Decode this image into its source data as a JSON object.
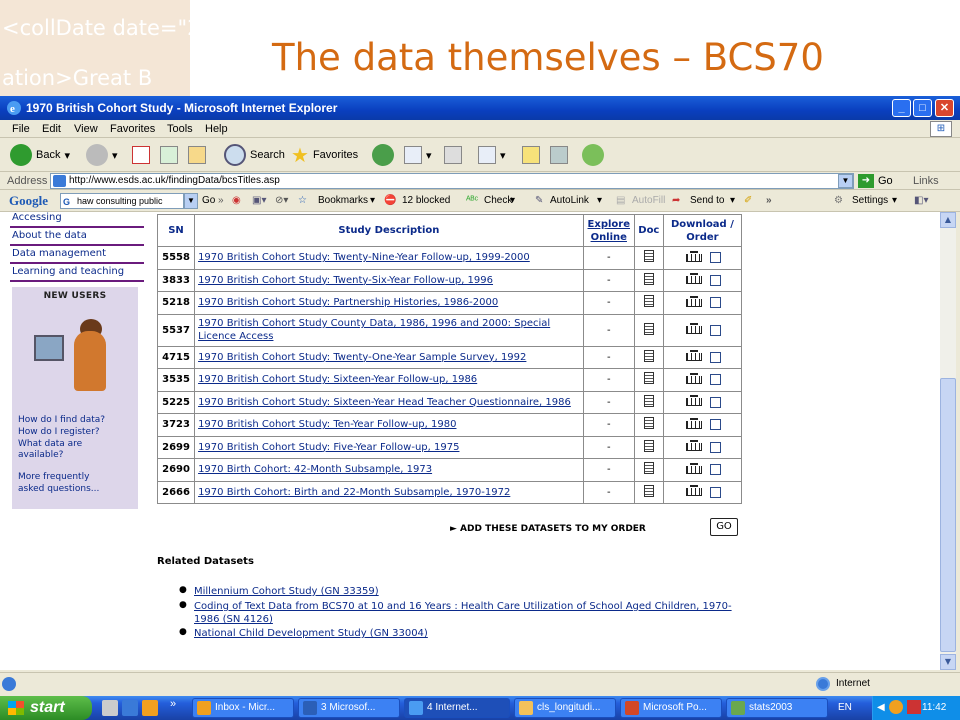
{
  "slide": {
    "title": "The data themselves – BCS70",
    "decor_line1": "<collDate date=\"2",
    "decor_line2": "ation>Great B"
  },
  "window": {
    "title": "1970 British Cohort Study - Microsoft Internet Explorer",
    "menu": [
      "File",
      "Edit",
      "View",
      "Favorites",
      "Tools",
      "Help"
    ],
    "toolbar": {
      "back": "Back",
      "search": "Search",
      "favorites": "Favorites"
    },
    "address_label": "Address",
    "url": "http://www.esds.ac.uk/findingData/bcsTitles.asp",
    "go": "Go",
    "links": "Links"
  },
  "google_bar": {
    "logo": "Google",
    "search_text": "haw consulting public",
    "go": "Go",
    "bookmarks": "Bookmarks",
    "blocked": "12 blocked",
    "check": "Check",
    "autolink": "AutoLink",
    "autofill": "AutoFill",
    "sendto": "Send to",
    "settings": "Settings"
  },
  "sidebar": {
    "links": [
      "Accessing",
      "About the data",
      "Data management",
      "Learning and teaching"
    ],
    "new_users": "NEW USERS",
    "help": [
      "How do I find data?",
      "How do I register?",
      "What data are",
      "available?",
      "More frequently",
      "asked questions..."
    ]
  },
  "table": {
    "headers": {
      "sn": "SN",
      "desc": "Study Description",
      "explore": "Explore Online",
      "doc": "Doc",
      "download": "Download / Order"
    },
    "rows": [
      {
        "sn": "5558",
        "desc": "1970 British Cohort Study: Twenty-Nine-Year Follow-up, 1999-2000",
        "explore": "-"
      },
      {
        "sn": "3833",
        "desc": "1970 British Cohort Study: Twenty-Six-Year Follow-up, 1996",
        "explore": "-"
      },
      {
        "sn": "5218",
        "desc": "1970 British Cohort Study: Partnership Histories, 1986-2000",
        "explore": "-"
      },
      {
        "sn": "5537",
        "desc": "1970 British Cohort Study County Data, 1986, 1996 and 2000: Special Licence Access",
        "explore": "-"
      },
      {
        "sn": "4715",
        "desc": "1970 British Cohort Study: Twenty-One-Year Sample Survey, 1992",
        "explore": "-"
      },
      {
        "sn": "3535",
        "desc": "1970 British Cohort Study: Sixteen-Year Follow-up, 1986",
        "explore": "-"
      },
      {
        "sn": "5225",
        "desc": "1970 British Cohort Study: Sixteen-Year Head Teacher Questionnaire, 1986",
        "explore": "-"
      },
      {
        "sn": "3723",
        "desc": "1970 British Cohort Study: Ten-Year Follow-up, 1980",
        "explore": "-"
      },
      {
        "sn": "2699",
        "desc": "1970 British Cohort Study: Five-Year Follow-up, 1975",
        "explore": "-"
      },
      {
        "sn": "2690",
        "desc": "1970 Birth Cohort: 42-Month Subsample, 1973",
        "explore": "-"
      },
      {
        "sn": "2666",
        "desc": "1970 Birth Cohort: Birth and 22-Month Subsample, 1970-1972",
        "explore": "-"
      }
    ],
    "add_label": "► ADD THESE DATASETS TO MY ORDER",
    "go": "GO"
  },
  "related": {
    "heading": "Related Datasets",
    "items": [
      "Millennium Cohort Study (GN 33359)",
      "Coding of Text Data from BCS70 at 10 and 16 Years : Health Care Utilization of School Aged Children, 1970-1986 (SN 4126)",
      "National Child Development Study (GN 33004)"
    ]
  },
  "status": {
    "zone": "Internet"
  },
  "taskbar": {
    "start": "start",
    "tasks": [
      "Inbox - Micr...",
      "3 Microsof...",
      "4 Internet...",
      "cls_longitudi...",
      "Microsoft Po...",
      "stats2003"
    ],
    "lang": "EN",
    "clock": "11:42"
  }
}
